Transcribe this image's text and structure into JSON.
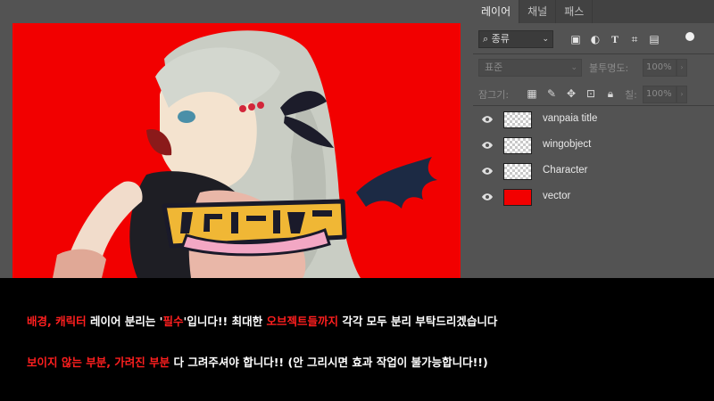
{
  "colors": {
    "canvas_background": "#f20000",
    "panel_background": "#535353",
    "tab_bar": "#424242",
    "highlight_text": "#ff1f1f",
    "normal_text": "#ffffff",
    "vector_layer_fill": "#f20000"
  },
  "layers_panel": {
    "tabs": [
      {
        "label": "레이어",
        "active": true
      },
      {
        "label": "채널",
        "active": false
      },
      {
        "label": "패스",
        "active": false
      }
    ],
    "filter": {
      "kind_label": "종류",
      "icons": [
        "image-filter-icon",
        "adjustment-filter-icon",
        "type-filter-icon",
        "shape-filter-icon",
        "smart-object-filter-icon"
      ]
    },
    "blend_mode": "표준",
    "opacity_label": "불투명도:",
    "opacity_value": "100%",
    "lock_label": "잠그기:",
    "fill_label": "칠:",
    "fill_value": "100%",
    "layers": [
      {
        "name": "vanpaia title",
        "visible": true,
        "thumb": "transparent"
      },
      {
        "name": "wingobject",
        "visible": true,
        "thumb": "transparent"
      },
      {
        "name": "Character",
        "visible": true,
        "thumb": "transparent"
      },
      {
        "name": "vector",
        "visible": true,
        "thumb": "solid"
      }
    ]
  },
  "instructions": {
    "line1": [
      {
        "text": "배경, 캐릭터",
        "highlight": true
      },
      {
        "text": " 레이어 분리는 '",
        "highlight": false
      },
      {
        "text": "필수",
        "highlight": true
      },
      {
        "text": "'입니다!! 최대한 ",
        "highlight": false
      },
      {
        "text": "오브젝트들까지",
        "highlight": true
      },
      {
        "text": " 각각 모두 분리 부탁드리겠습니다",
        "highlight": false
      }
    ],
    "line2": [
      {
        "text": "보이지 않는 부분, 가려진 부분",
        "highlight": true
      },
      {
        "text": " 다 그려주셔야 합니다!! (안 그리시면 효과 작업이 불가능합니다!!)",
        "highlight": false
      }
    ]
  }
}
